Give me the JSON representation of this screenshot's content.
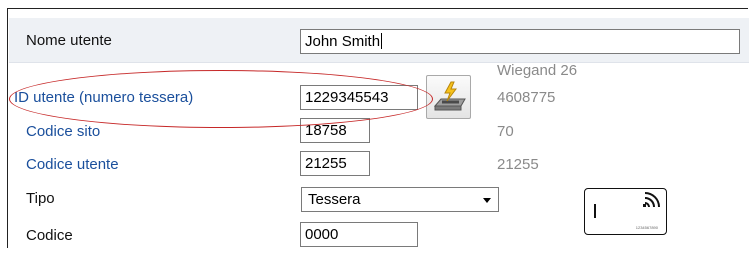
{
  "form": {
    "name_label": "Nome utente",
    "name_value": "John Smith",
    "wiegand_header": "Wiegand 26",
    "user_id_label": "ID utente  (numero tessera)",
    "user_id_value": "1229345543",
    "user_id_wiegand": "4608775",
    "site_code_label": "Codice sito",
    "site_code_value": "18758",
    "site_code_wiegand": "70",
    "user_code_label": "Codice utente",
    "user_code_value": "21255",
    "user_code_wiegand": "21255",
    "type_label": "Tipo",
    "type_value": "Tessera",
    "code_label": "Codice",
    "code_value": "0000",
    "card_number": "1234567890"
  },
  "icons": {
    "read_card_button": "card-reader-icon",
    "card_preview": "contactless-card-icon"
  },
  "colors": {
    "label_link": "#1a4f9c",
    "highlight_oval": "#c62828",
    "muted_value": "#8a8a8a"
  }
}
